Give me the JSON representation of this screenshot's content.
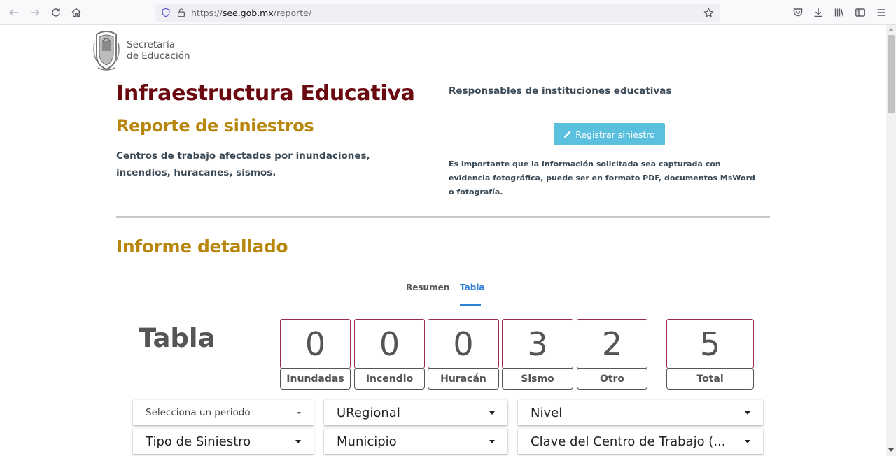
{
  "browser": {
    "url_scheme": "https://",
    "url_host": "see.gob.mx",
    "url_path": "/reporte/"
  },
  "header": {
    "logo_line1": "Secretaría",
    "logo_line2": "de Educación"
  },
  "hero": {
    "title": "Infraestructura Educativa",
    "subtitle": "Reporte de siniestros",
    "description": "Centros de trabajo afectados por inundaciones, incendios, huracanes, sismos.",
    "responsables_title": "Responsables de instituciones educativas",
    "register_button": "Registrar siniestro",
    "note": "Es importante que la información solicitada sea capturada con evidencia fotográfica, puede ser en formato PDF, documentos MsWord o fotografía."
  },
  "section": {
    "title": "Informe detallado",
    "tabs": [
      {
        "label": "Resumen",
        "active": false
      },
      {
        "label": "Tabla",
        "active": true
      }
    ]
  },
  "tabla": {
    "title": "Tabla",
    "stats": [
      {
        "value": "0",
        "label": "Inundadas"
      },
      {
        "value": "0",
        "label": "Incendio"
      },
      {
        "value": "0",
        "label": "Huracán"
      },
      {
        "value": "3",
        "label": "Sismo"
      },
      {
        "value": "2",
        "label": "Otro"
      },
      {
        "value": "5",
        "label": "Total"
      }
    ]
  },
  "filters": {
    "periodo": "Selecciona un periodo",
    "uregional": "URegional",
    "nivel": "Nivel",
    "tipo": "Tipo de Siniestro",
    "municipio": "Municipio",
    "clave": "Clave del Centro de Trabajo (..."
  },
  "colors": {
    "title": "#6a0a10",
    "accent": "#b8860b",
    "button": "#5bc0de",
    "tab_active": "#2f7fd8",
    "stat_border": "#9b2d4a"
  }
}
